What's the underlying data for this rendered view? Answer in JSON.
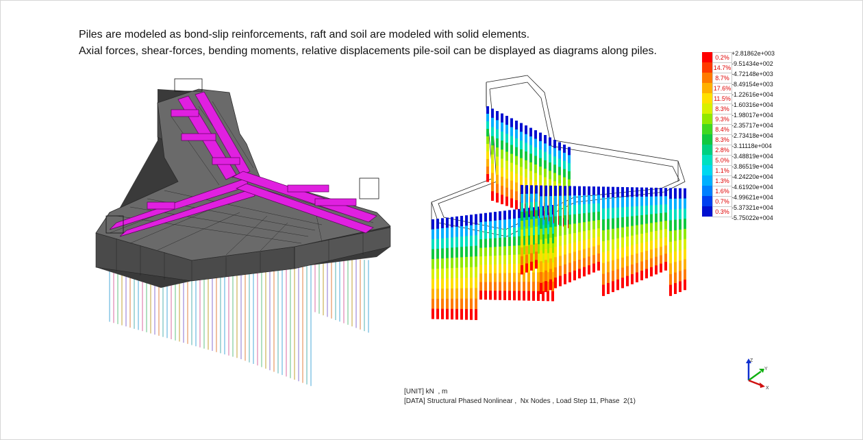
{
  "caption": {
    "line1": "Piles are modeled as bond-slip reinforcements, raft and soil are modeled with  solid elements.",
    "line2": "Axial forces, shear-forces, bending moments, relative displacements pile-soil can be displayed as diagrams along piles."
  },
  "legend": {
    "top_value": "+2.81862e+003",
    "entries": [
      {
        "pct": "0.2%",
        "value": "-9.51434e+002",
        "color": "#ff0000"
      },
      {
        "pct": "14.7%",
        "value": "-4.72148e+003",
        "color": "#ff3a00"
      },
      {
        "pct": "8.7%",
        "value": "-8.49154e+003",
        "color": "#ff7a00"
      },
      {
        "pct": "17.6%",
        "value": "-1.22616e+004",
        "color": "#ffb000"
      },
      {
        "pct": "11.5%",
        "value": "-1.60316e+004",
        "color": "#ffe000"
      },
      {
        "pct": "8.3%",
        "value": "-1.98017e+004",
        "color": "#d8f000"
      },
      {
        "pct": "9.3%",
        "value": "-2.35717e+004",
        "color": "#90e800"
      },
      {
        "pct": "8.4%",
        "value": "-2.73418e+004",
        "color": "#40d820"
      },
      {
        "pct": "8.3%",
        "value": "-3.11118e+004",
        "color": "#10c840"
      },
      {
        "pct": "2.8%",
        "value": "-3.48819e+004",
        "color": "#00d080"
      },
      {
        "pct": "5.0%",
        "value": "-3.86519e+004",
        "color": "#00e0c0"
      },
      {
        "pct": "1.1%",
        "value": "-4.24220e+004",
        "color": "#00d8f0"
      },
      {
        "pct": "1.3%",
        "value": "-4.61920e+004",
        "color": "#00b0ff"
      },
      {
        "pct": "1.6%",
        "value": "-4.99621e+004",
        "color": "#0080ff"
      },
      {
        "pct": "0.7%",
        "value": "-5.37321e+004",
        "color": "#0040f0"
      },
      {
        "pct": "0.3%",
        "value": "-5.75022e+004",
        "color": "#0010d0"
      }
    ]
  },
  "info": {
    "unit_line": "[UNIT] kN  , m",
    "data_line": "[DATA] Structural Phased Nonlinear ,  Nx Nodes , Load Step 11, Phase  2(1)"
  },
  "axes": {
    "z": "Z",
    "y": "Y",
    "x": "X"
  }
}
